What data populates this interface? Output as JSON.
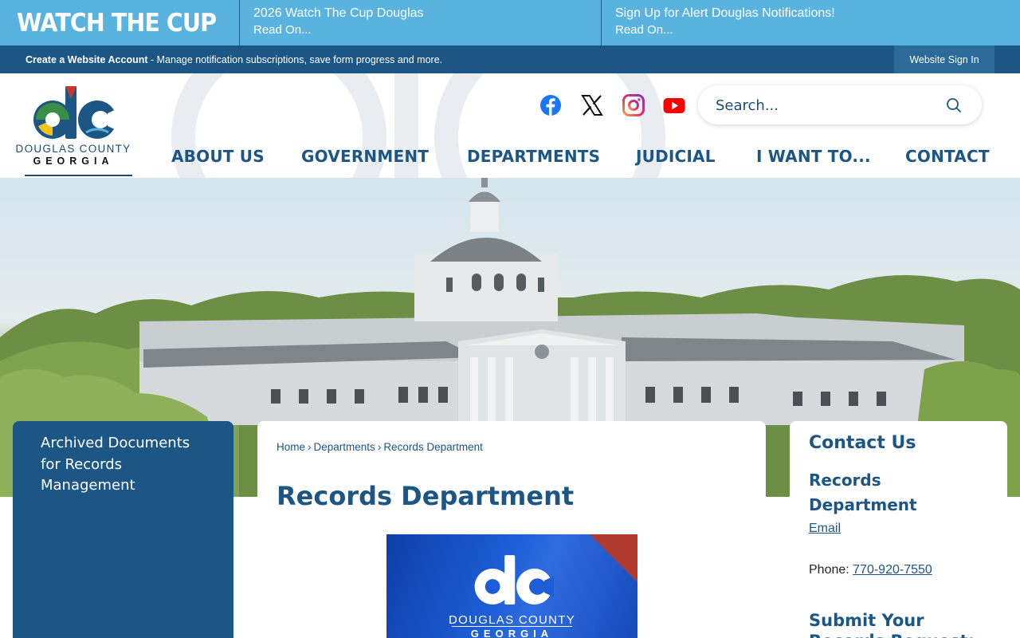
{
  "alert_bar": {
    "title": "WATCH THE CUP",
    "items": [
      {
        "headline": "2026 Watch The Cup Douglas",
        "link": "Read On..."
      },
      {
        "headline": "Sign Up for Alert Douglas Notifications!",
        "link": "Read On..."
      }
    ]
  },
  "account_bar": {
    "create_link": "Create a Website Account",
    "description": " - Manage notification subscriptions, save form progress and more.",
    "sign_in": "Website Sign In"
  },
  "logo": {
    "line1": "DOUGLAS COUNTY",
    "line2": "GEORGIA"
  },
  "social": [
    "facebook-icon",
    "x-icon",
    "instagram-icon",
    "youtube-icon"
  ],
  "search": {
    "placeholder": "Search...",
    "icon": "search-icon"
  },
  "nav": [
    "ABOUT US",
    "GOVERNMENT",
    "DEPARTMENTS",
    "JUDICIAL",
    "I WANT TO...",
    "CONTACT"
  ],
  "sidebar": {
    "items": [
      "Archived Documents for Records Management"
    ]
  },
  "breadcrumb": [
    "Home",
    "Departments",
    "Records Department"
  ],
  "page_title": "Records Department",
  "banner": {
    "line1": "DOUGLAS COUNTY",
    "line2": "GEORGIA"
  },
  "contact": {
    "title": "Contact Us",
    "department": "Records Department",
    "email_label": "Email",
    "phone_label": "Phone: ",
    "phone": "770-920-7550",
    "submit_heading": "Submit Your Records Request:"
  },
  "colors": {
    "alert_bg": "#5ab2df",
    "primary": "#1c5685",
    "logo_green": "#3a8e46",
    "logo_yellow": "#f3c21b",
    "logo_red": "#c8382f"
  }
}
